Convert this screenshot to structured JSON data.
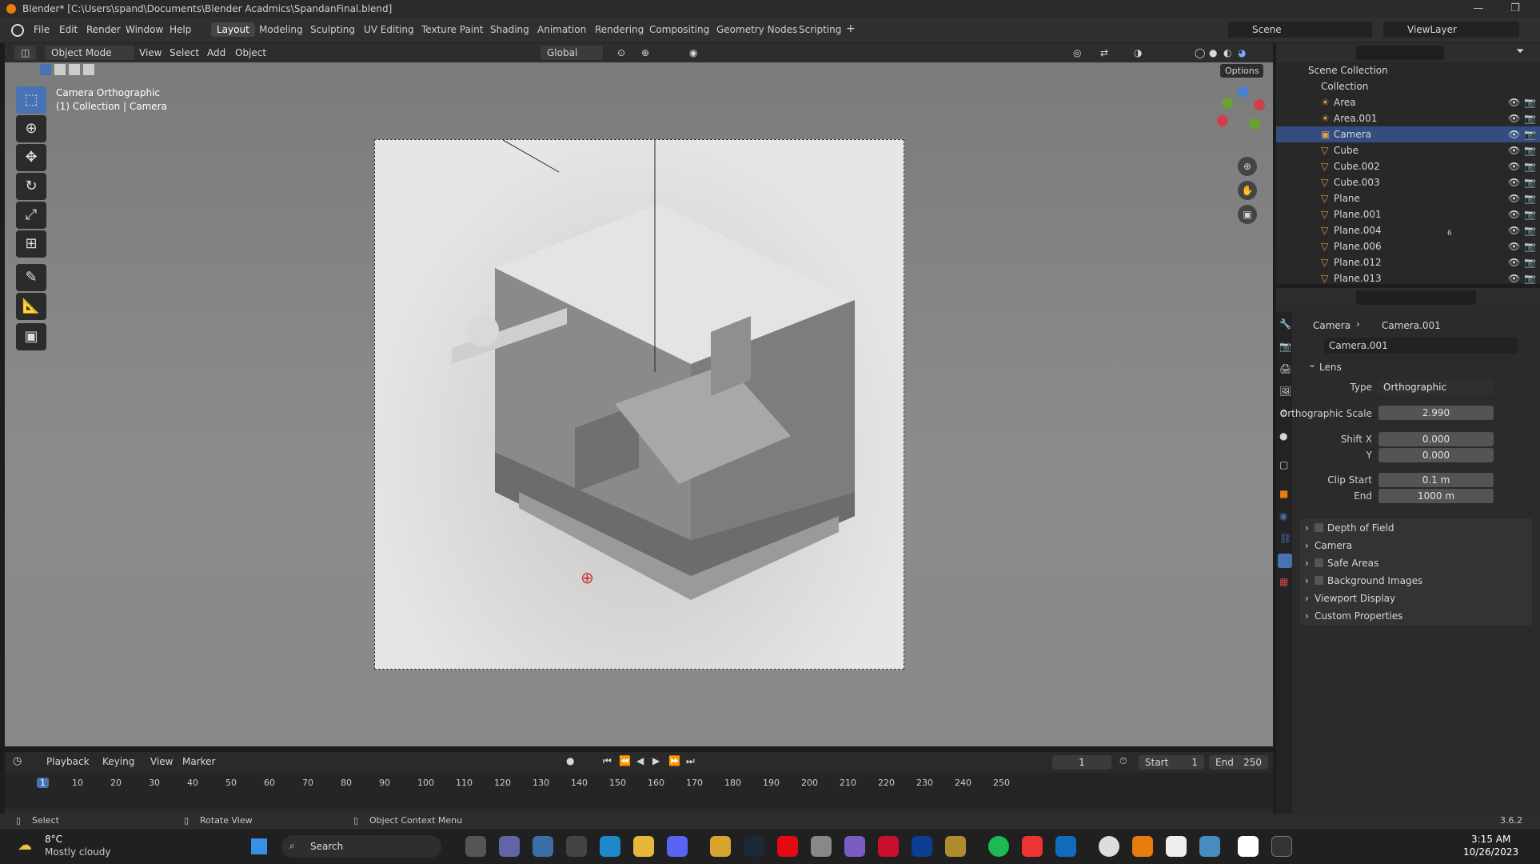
{
  "window": {
    "title": "Blender* [C:\\Users\\spand\\Documents\\Blender Acadmics\\SpandanFinal.blend]"
  },
  "menu": [
    "File",
    "Edit",
    "Render",
    "Window",
    "Help"
  ],
  "workspaces": [
    "Layout",
    "Modeling",
    "Sculpting",
    "UV Editing",
    "Texture Paint",
    "Shading",
    "Animation",
    "Rendering",
    "Compositing",
    "Geometry Nodes",
    "Scripting"
  ],
  "scene": {
    "label": "Scene",
    "viewlayer": "ViewLayer"
  },
  "viewport_header": {
    "mode": "Object Mode",
    "view": "View",
    "select": "Select",
    "add": "Add",
    "object": "Object",
    "orientation": "Global",
    "options": "Options"
  },
  "viewport": {
    "camera_label": "Camera Orthographic",
    "collection_label": "(1) Collection | Camera"
  },
  "outliner": {
    "scene_collection": "Scene Collection",
    "collection": "Collection",
    "items": [
      "Area",
      "Area.001",
      "Camera",
      "Cube",
      "Cube.002",
      "Cube.003",
      "Plane",
      "Plane.001",
      "Plane.004",
      "Plane.006",
      "Plane.012",
      "Plane.013"
    ],
    "selected": "Camera",
    "plane004_modifier_count": "6"
  },
  "properties": {
    "breadcrumb_object": "Camera",
    "breadcrumb_data": "Camera.001",
    "datablock": "Camera.001",
    "lens_title": "Lens",
    "type_label": "Type",
    "type_value": "Orthographic",
    "ortho_scale_label": "Orthographic Scale",
    "ortho_scale_value": "2.990",
    "shift_x_label": "Shift X",
    "shift_x_value": "0.000",
    "shift_y_label": "Y",
    "shift_y_value": "0.000",
    "clip_start_label": "Clip Start",
    "clip_start_value": "0.1 m",
    "clip_end_label": "End",
    "clip_end_value": "1000 m",
    "panels": [
      "Depth of Field",
      "Camera",
      "Safe Areas",
      "Background Images",
      "Viewport Display",
      "Custom Properties"
    ]
  },
  "timeline": {
    "playback": "Playback",
    "keying": "Keying",
    "view": "View",
    "marker": "Marker",
    "current_frame": "1",
    "start_label": "Start",
    "start": "1",
    "end_label": "End",
    "end": "250",
    "ticks": [
      "1",
      "10",
      "20",
      "30",
      "40",
      "50",
      "60",
      "70",
      "80",
      "90",
      "100",
      "110",
      "120",
      "130",
      "140",
      "150",
      "160",
      "170",
      "180",
      "190",
      "200",
      "210",
      "220",
      "230",
      "240",
      "250"
    ]
  },
  "statusbar": {
    "select": "Select",
    "rotate": "Rotate View",
    "context": "Object Context Menu",
    "version": "3.6.2"
  },
  "taskbar": {
    "temp": "8°C",
    "weather": "Mostly cloudy",
    "search": "Search",
    "time": "3:15 AM",
    "date": "10/26/2023"
  }
}
